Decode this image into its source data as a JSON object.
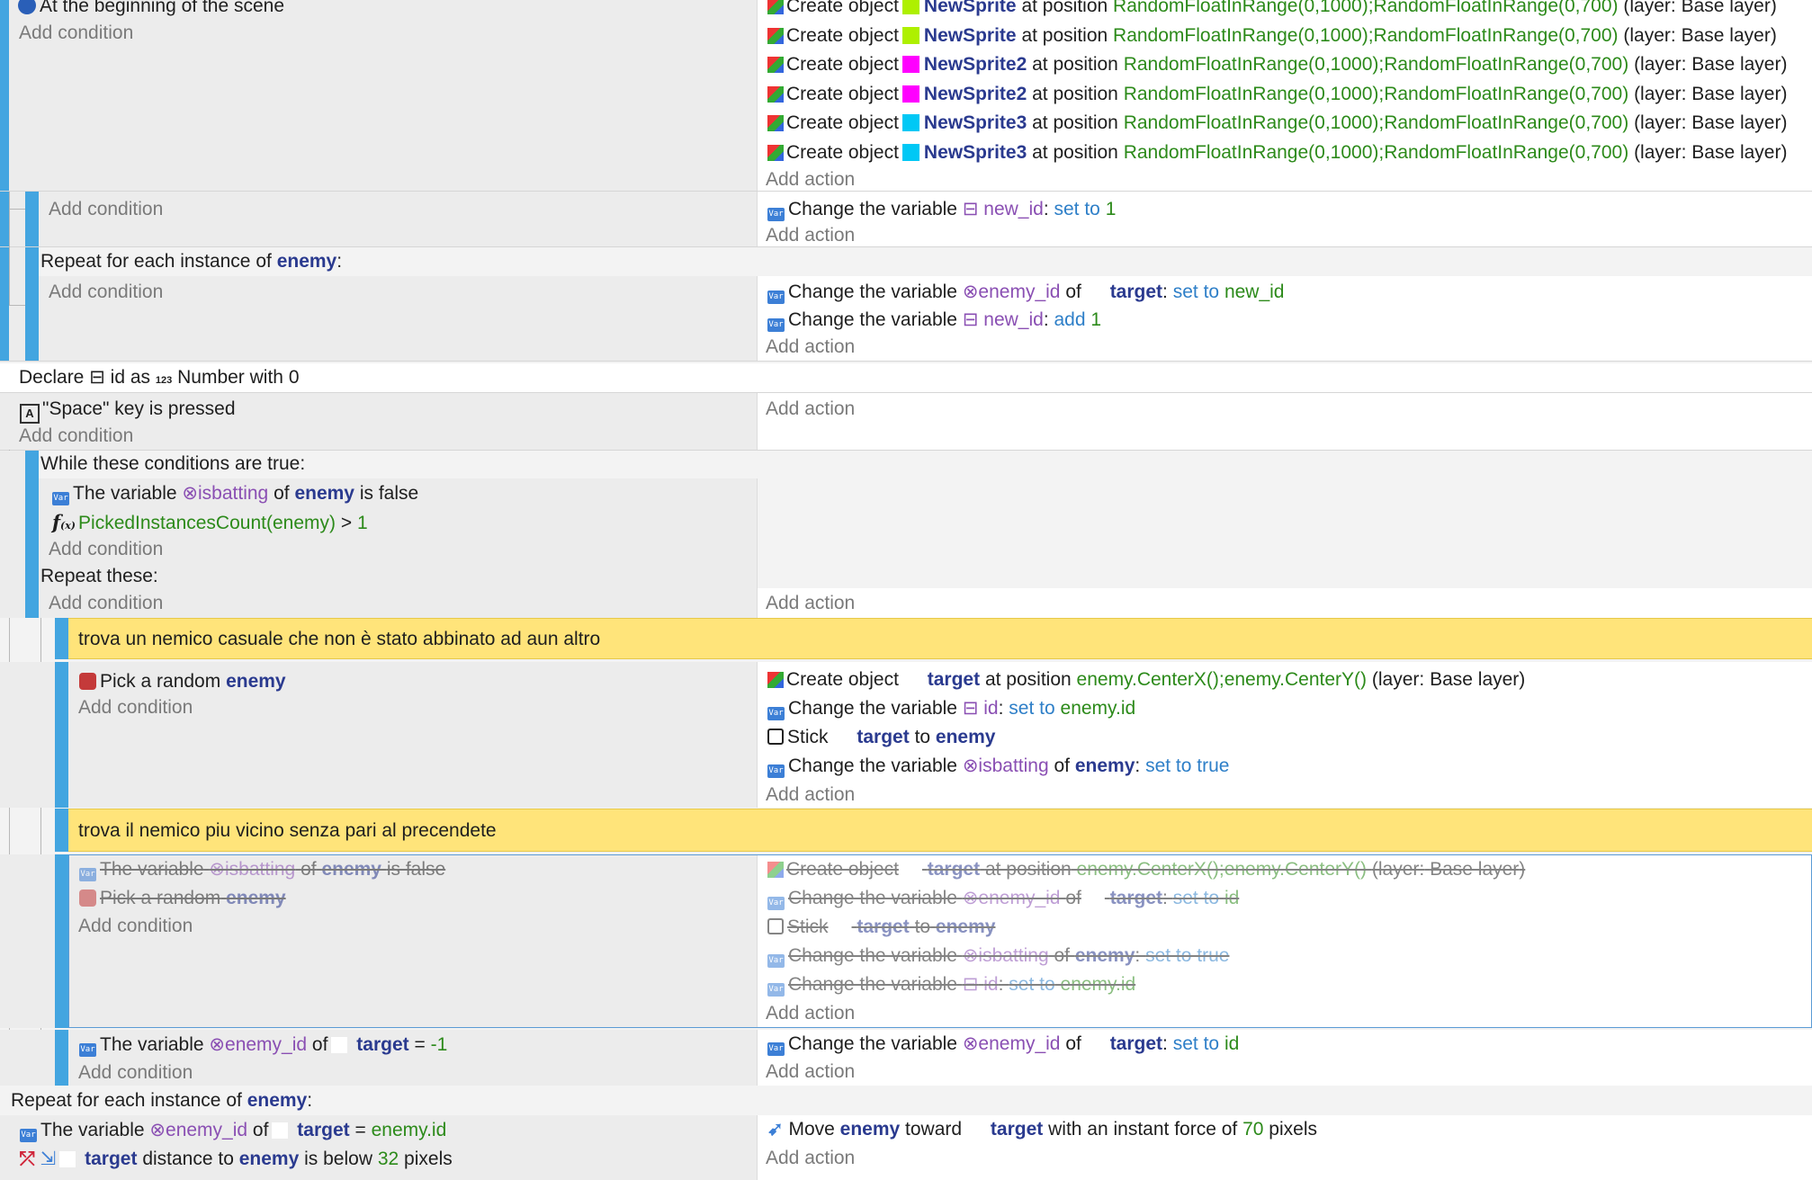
{
  "colors": {
    "accent_bar": "#43a5e0",
    "comment_bg": "#ffe47a",
    "object": "#2a3a8f",
    "variable": "#8a4fb3",
    "operator": "#2e7fc8",
    "value": "#2c8a1a",
    "lime": "#aef000",
    "magenta": "#ff00ff",
    "cyan": "#00c8f5"
  },
  "common": {
    "add_condition": "Add condition",
    "add_action": "Add action",
    "create_object": "Create object",
    "at_position": "at position",
    "layer_open": "(layer:",
    "layer_close": ")",
    "base_layer": "Base layer",
    "change_variable": "Change the variable",
    "of": "of",
    "the_variable": "The variable",
    "stick": "Stick",
    "to": "to"
  },
  "e1": {
    "condition": "At the beginning of the scene",
    "actions": [
      {
        "obj": "NewSprite",
        "pos": "RandomFloatInRange(0,1000);RandomFloatInRange(0,700)"
      },
      {
        "obj": "NewSprite",
        "pos": "RandomFloatInRange(0,1000);RandomFloatInRange(0,700)"
      },
      {
        "obj": "NewSprite2",
        "pos": "RandomFloatInRange(0,1000);RandomFloatInRange(0,700)"
      },
      {
        "obj": "NewSprite2",
        "pos": "RandomFloatInRange(0,1000);RandomFloatInRange(0,700)"
      },
      {
        "obj": "NewSprite3",
        "pos": "RandomFloatInRange(0,1000);RandomFloatInRange(0,700)"
      },
      {
        "obj": "NewSprite3",
        "pos": "RandomFloatInRange(0,1000);RandomFloatInRange(0,700)"
      }
    ]
  },
  "e2": {
    "var": "new_id",
    "op": "set to",
    "val": "1"
  },
  "e3": {
    "header": "Repeat for each instance of",
    "obj": "enemy",
    "a1": {
      "var": "enemy_id",
      "target": "target",
      "op": "set to",
      "val": "new_id"
    },
    "a2": {
      "var": "new_id",
      "op": "add",
      "val": "1"
    }
  },
  "declare": {
    "prefix": "Declare",
    "var": "id",
    "as": "as",
    "type": "Number with 0"
  },
  "space": {
    "key": "\"Space\" key is pressed"
  },
  "while": {
    "header": "While these conditions are true:",
    "c1": {
      "var": "isbatting",
      "obj": "enemy",
      "tail": "is false"
    },
    "c2": {
      "expr": "PickedInstancesCount(enemy)",
      "cmp": ">",
      "val": "1"
    },
    "repeat": "Repeat these:"
  },
  "comment1": "trova un nemico casuale che non è stato abbinato ad aun altro",
  "pick": {
    "cond": "Pick a random",
    "obj": "enemy",
    "a1": {
      "obj": "target",
      "pos": "enemy.CenterX();enemy.CenterY()"
    },
    "a2": {
      "var": "id",
      "op": "set to",
      "val": "enemy.id"
    },
    "a3": {
      "obj": "target",
      "obj2": "enemy"
    },
    "a4": {
      "var": "isbatting",
      "obj": "enemy",
      "op": "set to true"
    }
  },
  "comment2": "trova il nemico piu vicino senza pari al precendete",
  "disabled": {
    "c1": {
      "var": "isbatting",
      "obj": "enemy",
      "tail": "is false"
    },
    "c2": {
      "cond": "Pick a random",
      "obj": "enemy"
    },
    "a1": {
      "obj": "target",
      "pos": "enemy.CenterX();enemy.CenterY()"
    },
    "a2": {
      "var": "enemy_id",
      "target": "target",
      "op": "set to",
      "val": "id"
    },
    "a3": {
      "obj": "target",
      "obj2": "enemy"
    },
    "a4": {
      "var": "isbatting",
      "obj": "enemy",
      "op": "set to true"
    },
    "a5": {
      "var": "id",
      "op": "set to",
      "val": "enemy.id"
    }
  },
  "enemyid": {
    "c": {
      "var": "enemy_id",
      "target": "target",
      "cmp": "=",
      "val": "-1"
    },
    "a": {
      "var": "enemy_id",
      "target": "target",
      "op": "set to",
      "val": "id"
    }
  },
  "last": {
    "header": "Repeat for each instance of",
    "obj": "enemy",
    "c1": {
      "var": "enemy_id",
      "target": "target",
      "cmp": "=",
      "val": "enemy.id"
    },
    "c2": {
      "target": "target",
      "mid": "distance to",
      "obj": "enemy",
      "tail": "is below",
      "val": "32",
      "unit": "pixels"
    },
    "a": {
      "move": "Move",
      "obj": "enemy",
      "toward": "toward",
      "target": "target",
      "with": "with an instant force of",
      "val": "70",
      "unit": "pixels"
    }
  }
}
